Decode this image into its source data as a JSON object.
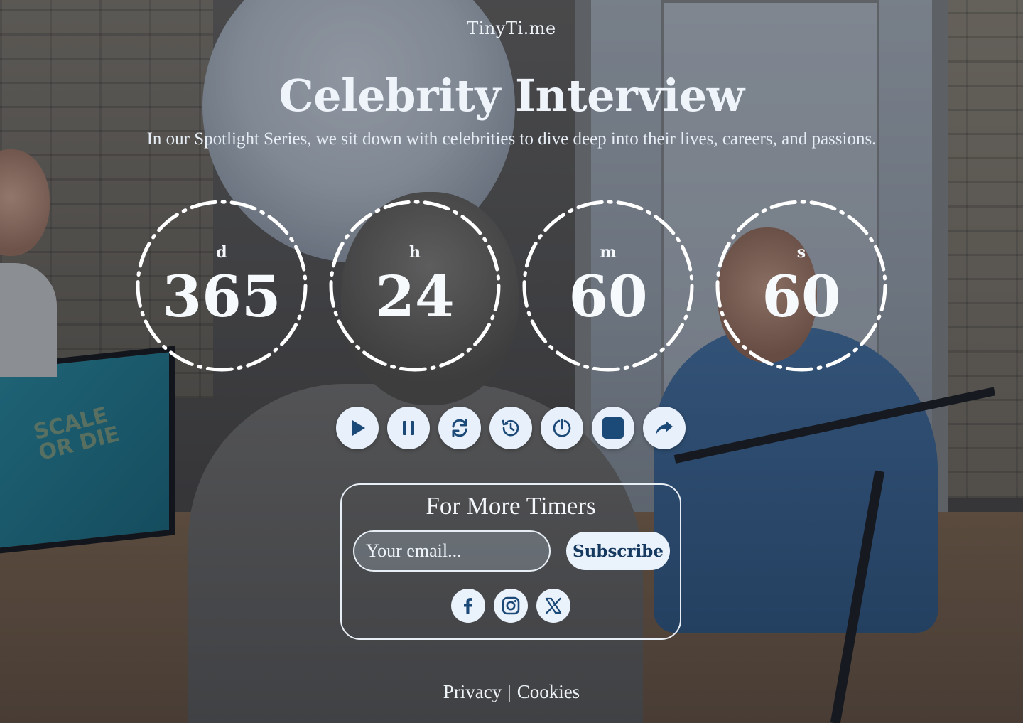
{
  "brand": "TinyTi.me",
  "title": "Celebrity Interview",
  "subtitle": "In our Spotlight Series, we sit down with celebrities to dive deep into their lives, careers, and passions.",
  "countdown": [
    {
      "unit": "d",
      "value": "365"
    },
    {
      "unit": "h",
      "value": "24"
    },
    {
      "unit": "m",
      "value": "60"
    },
    {
      "unit": "s",
      "value": "60"
    }
  ],
  "controls": [
    {
      "icon": "play-icon"
    },
    {
      "icon": "pause-icon"
    },
    {
      "icon": "refresh-icon"
    },
    {
      "icon": "history-icon"
    },
    {
      "icon": "timer-icon"
    },
    {
      "icon": "stop-icon"
    },
    {
      "icon": "share-icon"
    }
  ],
  "newsletter": {
    "title": "For More Timers",
    "email_placeholder": "Your email...",
    "subscribe_label": "Subscribe"
  },
  "socials": [
    {
      "icon": "facebook-icon"
    },
    {
      "icon": "instagram-icon"
    },
    {
      "icon": "x-icon"
    }
  ],
  "footer": {
    "privacy": "Privacy",
    "separator": "|",
    "cookies": "Cookies"
  },
  "colors": {
    "icon": "#1c4a78",
    "button_bg": "#e8f1fb",
    "text": "#f1f6fb"
  }
}
